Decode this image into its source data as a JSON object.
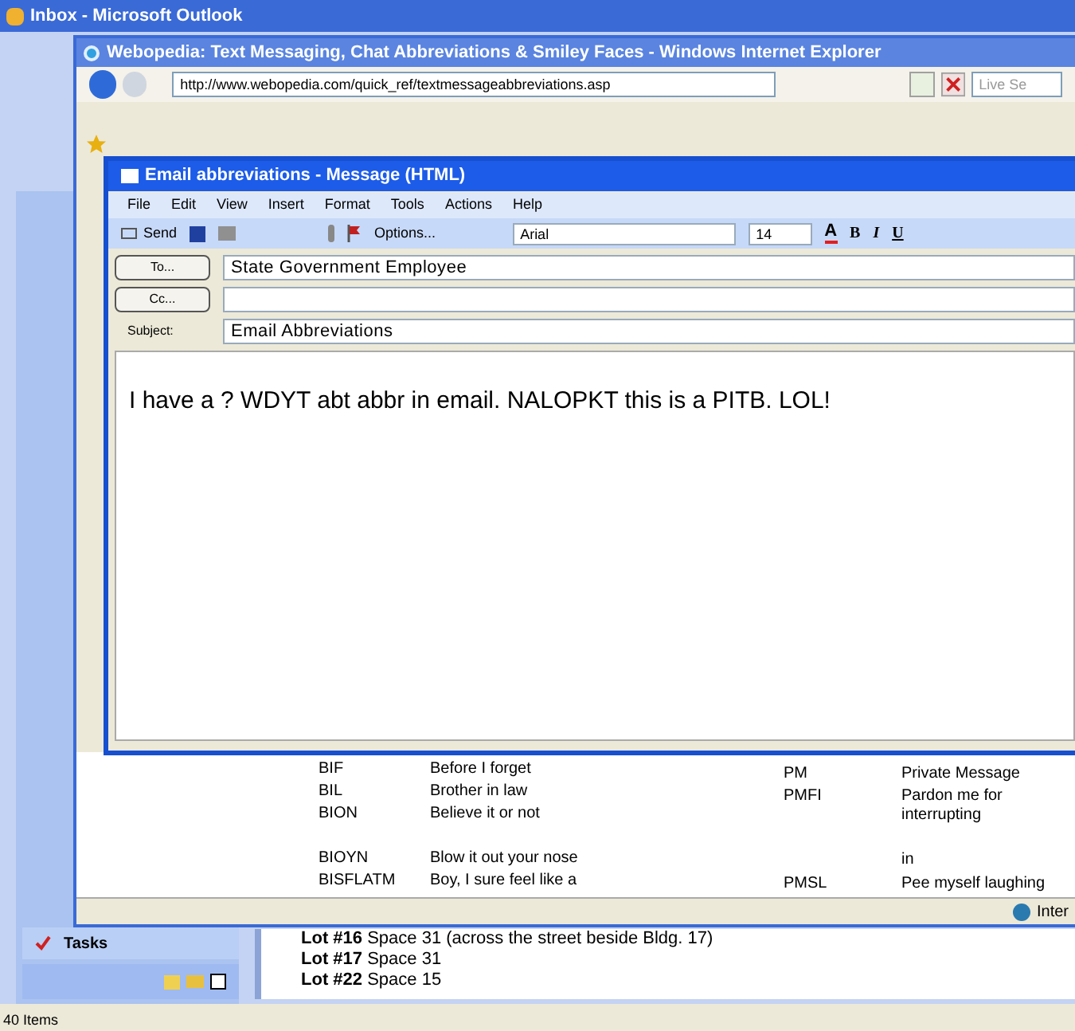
{
  "outlook": {
    "title": "Inbox - Microsoft Outlook",
    "nav": {
      "label": "Tasks"
    },
    "lines": [
      {
        "bold": "Lot #16",
        "rest": "Space 31 (across the street beside Bldg. 17)"
      },
      {
        "bold": "Lot #17",
        "rest": "Space 31"
      },
      {
        "bold": "Lot #22",
        "rest": "Space 15"
      }
    ],
    "status": "40 Items"
  },
  "browser": {
    "title": "Webopedia: Text Messaging, Chat Abbreviations & Smiley Faces - Windows Internet Explorer",
    "address": "http://www.webopedia.com/quick_ref/textmessageabbreviations.asp",
    "search_placeholder": "Live Se",
    "status": "Inter",
    "left_groups": [
      [
        {
          "abbr": "BIF",
          "meaning": "Before I forget"
        },
        {
          "abbr": "BIL",
          "meaning": "Brother in law"
        },
        {
          "abbr": "BION",
          "meaning": "Believe it or not"
        }
      ],
      [
        {
          "abbr": "BIOYN",
          "meaning": "Blow it out your nose"
        },
        {
          "abbr": "BISFLATM",
          "meaning": "Boy, I sure feel like a"
        }
      ]
    ],
    "right_rows": [
      {
        "abbr": "PM",
        "meaning": "Private Message"
      },
      {
        "abbr": "PMFI",
        "meaning": "Pardon me for interrupting"
      },
      {
        "meaning": "in"
      },
      {
        "abbr": "PMSL",
        "meaning": "Pee myself laughing"
      }
    ]
  },
  "message": {
    "title": "Email abbreviations - Message (HTML)",
    "menu": [
      "File",
      "Edit",
      "View",
      "Insert",
      "Format",
      "Tools",
      "Actions",
      "Help"
    ],
    "send": "Send",
    "options": "Options...",
    "font": "Arial",
    "size": "14",
    "font_color": "A",
    "format_buttons": [
      "B",
      "I",
      "U"
    ],
    "to": {
      "button": "To...",
      "value": "State Government Employee"
    },
    "cc": {
      "button": "Cc..."
    },
    "subject": {
      "label": "Subject:",
      "value": "Email Abbreviations"
    },
    "body": "I have a ? WDYT abt abbr in email. NALOPKT this is a PITB. LOL!"
  }
}
